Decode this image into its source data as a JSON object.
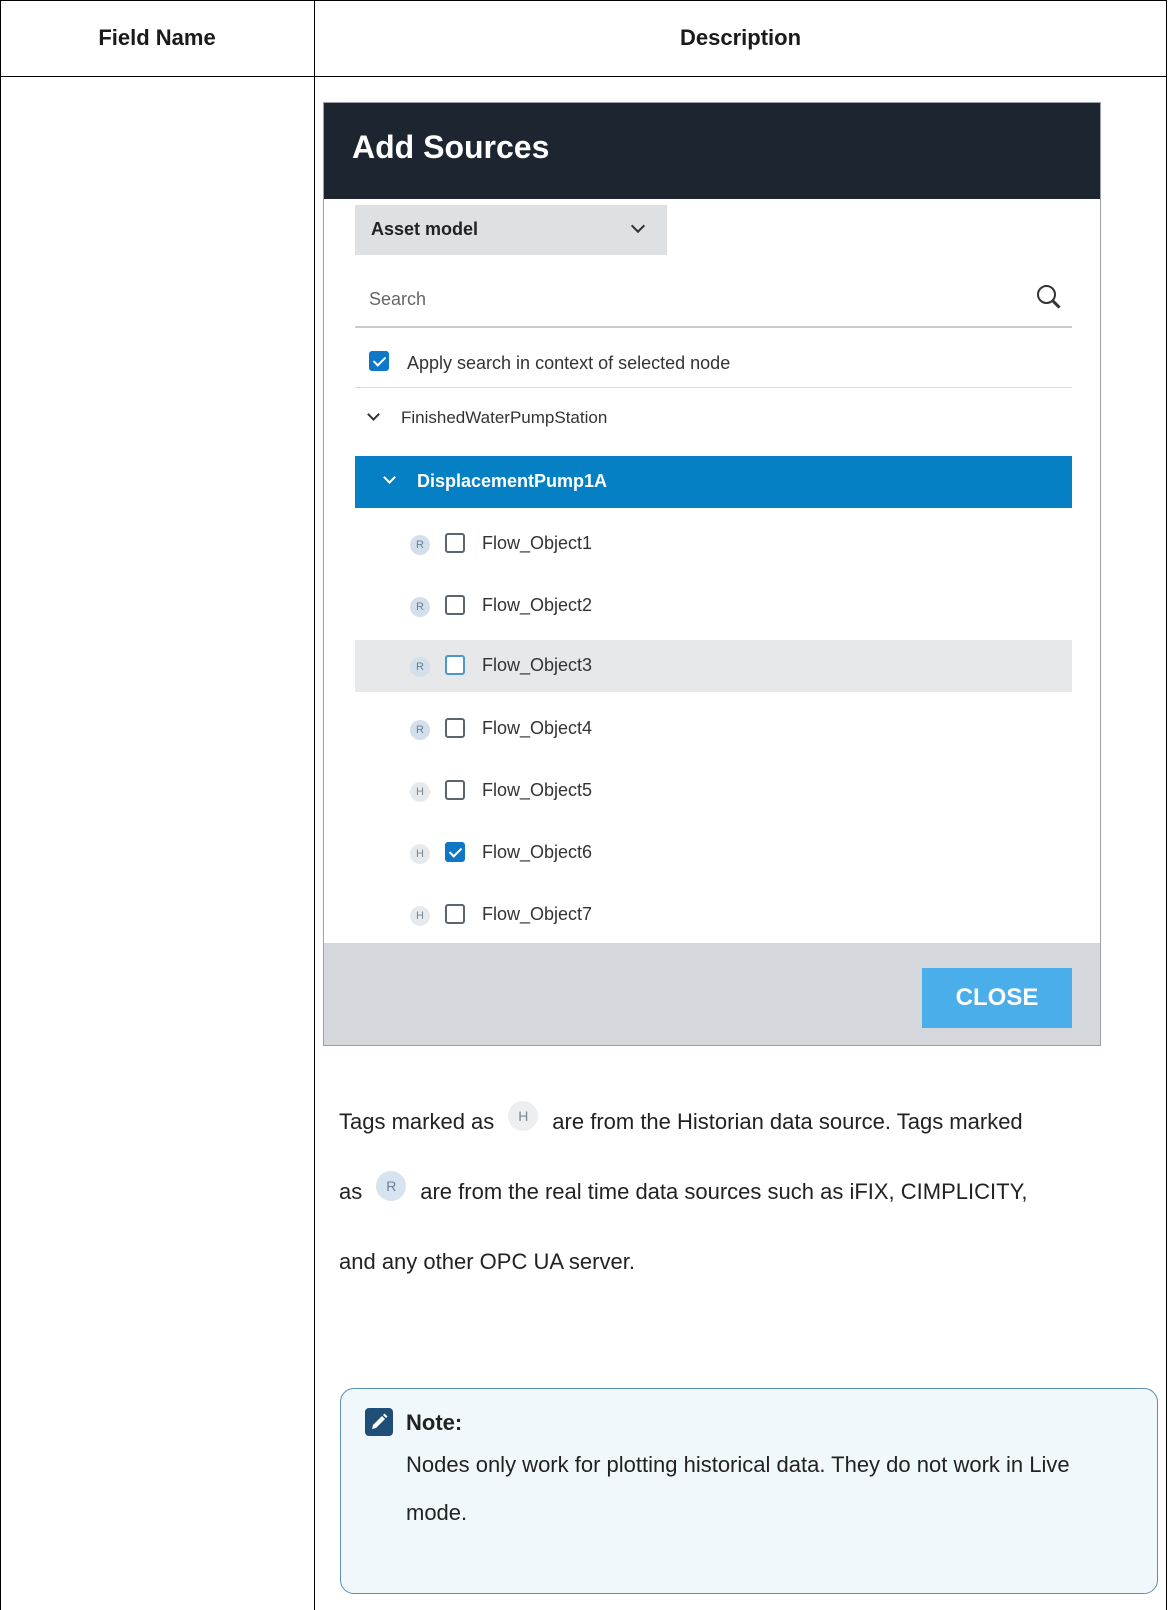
{
  "table": {
    "col_field_name": "Field Name",
    "col_description": "Description"
  },
  "dialog": {
    "title": "Add Sources",
    "dropdown_value": "Asset model",
    "search_placeholder": "Search",
    "apply_search_label": "Apply search in context of selected node",
    "apply_search_checked": true,
    "tree": {
      "root": "FinishedWaterPumpStation",
      "selected_node": "DisplacementPump1A",
      "items": [
        {
          "badge": "R",
          "label": "Flow_Object1",
          "checked": false
        },
        {
          "badge": "R",
          "label": "Flow_Object2",
          "checked": false
        },
        {
          "badge": "R",
          "label": "Flow_Object3",
          "checked": false
        },
        {
          "badge": "R",
          "label": "Flow_Object4",
          "checked": false
        },
        {
          "badge": "H",
          "label": "Flow_Object5",
          "checked": false
        },
        {
          "badge": "H",
          "label": "Flow_Object6",
          "checked": true
        },
        {
          "badge": "H",
          "label": "Flow_Object7",
          "checked": false
        }
      ]
    },
    "close_label": "CLOSE"
  },
  "description": {
    "part1": "Tags marked as",
    "badge_h": "H",
    "part2": "are from the Historian data source. Tags marked",
    "part3": "as",
    "badge_r": "R",
    "part4": "are from the real time data sources such as iFIX, CIMPLICITY,",
    "part5": "and any other OPC UA server."
  },
  "note": {
    "title": "Note:",
    "body": "Nodes only work for plotting historical data. They do not work in Live mode."
  },
  "colors": {
    "header_bar": "#1d2630",
    "selected_row": "#0680c5",
    "close_button": "#4aaeea",
    "note_border": "#5c8fb5"
  }
}
